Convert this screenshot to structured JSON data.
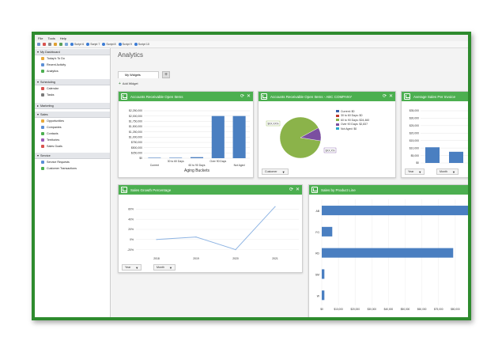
{
  "menubar": {
    "items": [
      "File",
      "Tools",
      "Help"
    ]
  },
  "toolbar": {
    "scripts": [
      "Script 6",
      "Script 7",
      "Script 8",
      "Script 9",
      "Script 10"
    ]
  },
  "sidebar": {
    "groups": [
      {
        "title": "My Dashboard",
        "items": [
          "Today's To Do",
          "Recent Activity",
          "Analytics"
        ]
      },
      {
        "title": "Scheduling",
        "items": [
          "Calendar",
          "Tasks"
        ]
      },
      {
        "title": "Marketing",
        "items": []
      },
      {
        "title": "Sales",
        "items": [
          "Opportunities",
          "Companies",
          "Contacts",
          "Territories",
          "Sales Goals"
        ]
      },
      {
        "title": "Service",
        "items": [
          "Service Requests",
          "Customer Transactions"
        ]
      }
    ]
  },
  "main": {
    "title": "Analytics",
    "tab_label": "My Widgets",
    "add_tab": "+",
    "add_widget": "Add Widget"
  },
  "widgets": {
    "ar_open": {
      "title": "Accounts Receivable Open Items"
    },
    "ar_open_abc": {
      "title": "Accounts Receivable Open Items - ABC COMPANY",
      "filter_label": "Customer",
      "callout_left": "$XX.XX%",
      "callout_right": "$XX.X%"
    },
    "avg_sales": {
      "title": "Average Sales Per Invoice",
      "filter_year": "Year",
      "filter_month": "Month"
    },
    "growth": {
      "title": "Sales Growth Percentage",
      "filter_year": "Year",
      "filter_month": "Month"
    },
    "by_product": {
      "title": "Sales by Product Line"
    }
  },
  "colors": {
    "accent": "#4caf50",
    "frame": "#2e8b2e",
    "bar": "#4a7fc1",
    "line": "#8eb4e3"
  },
  "chart_data": [
    {
      "type": "bar",
      "title": "Accounts Receivable Open Items",
      "xlabel": "Aging Buckets",
      "categories_top": [
        "",
        "30 to 60 Days",
        "",
        "Over 90 Days",
        ""
      ],
      "categories_bottom": [
        "Current",
        "",
        "60 to 90 Days",
        "",
        "Not Aged"
      ],
      "values": [
        0,
        0,
        50000,
        2000000,
        2000000
      ],
      "yticks": [
        "$0",
        "$250,000",
        "$500,000",
        "$750,000",
        "$1,000,000",
        "$1,250,000",
        "$1,500,000",
        "$1,750,000",
        "$2,000,000",
        "$2,250,000"
      ],
      "ylim": [
        0,
        2250000
      ]
    },
    {
      "type": "pie",
      "title": "Accounts Receivable Open Items - ABC COMPANY",
      "labels": [
        "Current: $0",
        "30 to 60 Days: $0",
        "60 to 90 Days: $24,460",
        "Over 90 Days: $2,837",
        "Not Aged: $0"
      ],
      "values": [
        0,
        0,
        24460,
        2837,
        0
      ],
      "colors": [
        "#3a5fa8",
        "#c0392b",
        "#8bb34a",
        "#7b4fa0",
        "#2aa7c9"
      ]
    },
    {
      "type": "bar",
      "title": "Average Sales Per Invoice",
      "yticks": [
        "$0",
        "$5,000",
        "$10,000",
        "$15,000",
        "$20,000",
        "$25,000",
        "$30,000",
        "$35,000"
      ],
      "values": [
        10500,
        7500,
        11000
      ],
      "ylim": [
        0,
        35000
      ]
    },
    {
      "type": "line",
      "title": "Sales Growth Percentage",
      "x": [
        "2018",
        "2019",
        "2020",
        "2021"
      ],
      "values": [
        0,
        5,
        -20,
        65
      ],
      "yticks": [
        "-20%",
        "0%",
        "20%",
        "40%",
        "60%"
      ],
      "ylim": [
        -30,
        70
      ]
    },
    {
      "type": "bar",
      "orientation": "horizontal",
      "title": "Sales by Product Line",
      "categories": [
        "AB",
        "FG",
        "RD",
        "SM",
        "W"
      ],
      "values": [
        90000,
        6000,
        75000,
        1500,
        1500
      ],
      "xticks": [
        "$0",
        "$10,000",
        "$20,000",
        "$30,000",
        "$40,000",
        "$50,000",
        "$60,000",
        "$75,000",
        "$80,000"
      ],
      "xlim": [
        0,
        90000
      ]
    }
  ]
}
